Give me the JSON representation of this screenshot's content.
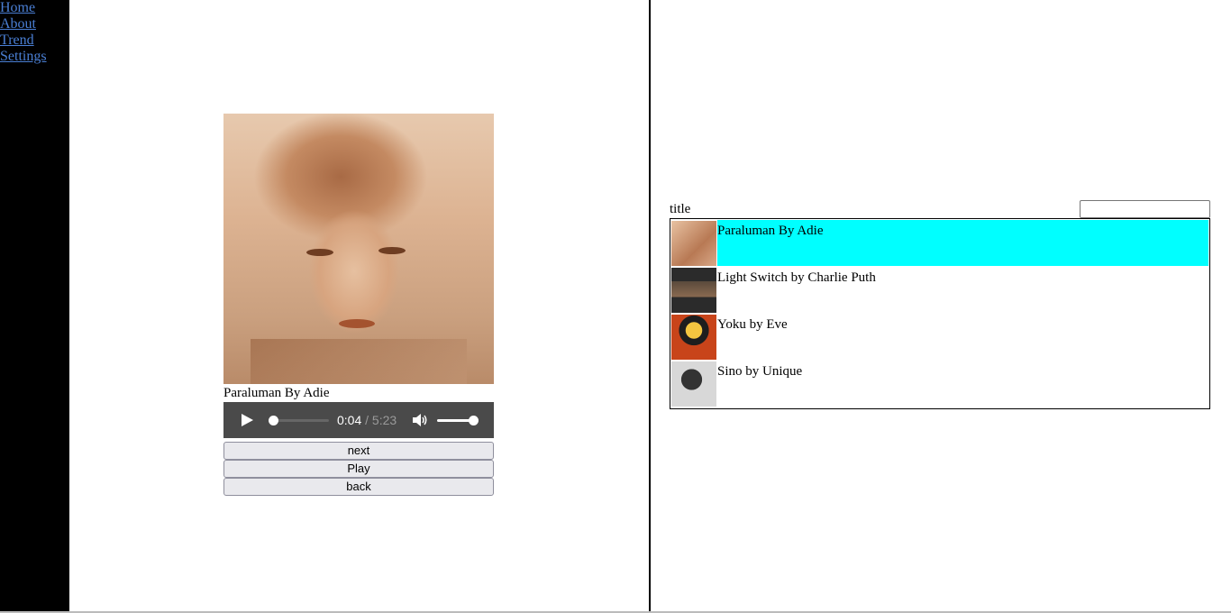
{
  "nav": {
    "items": [
      "Home",
      "About",
      "Trend",
      "Settings"
    ]
  },
  "player": {
    "now_playing": "Paraluman By Adie",
    "current_time": "0:04",
    "time_separator": " / ",
    "duration": "5:23",
    "progress_fraction": 0.0124,
    "volume_fraction": 1.0,
    "next_label": "next",
    "play_label": "Play",
    "back_label": "back"
  },
  "playlist": {
    "header_label": "title",
    "search_value": "",
    "items": [
      {
        "title": "Paraluman By Adie",
        "thumb_icon": "portrait-painting-thumbnail",
        "active": true
      },
      {
        "title": "Light Switch by Charlie Puth",
        "thumb_icon": "light-switch-album-thumbnail",
        "active": false
      },
      {
        "title": "Yoku by Eve",
        "thumb_icon": "anime-character-thumbnail",
        "active": false
      },
      {
        "title": "Sino by Unique",
        "thumb_icon": "bw-portrait-thumbnail",
        "active": false
      }
    ],
    "active_color": "#00ffff"
  },
  "colors": {
    "sidebar_bg": "#000000",
    "link_color": "#4a7fd4",
    "audio_bg": "#4a4a4a"
  }
}
